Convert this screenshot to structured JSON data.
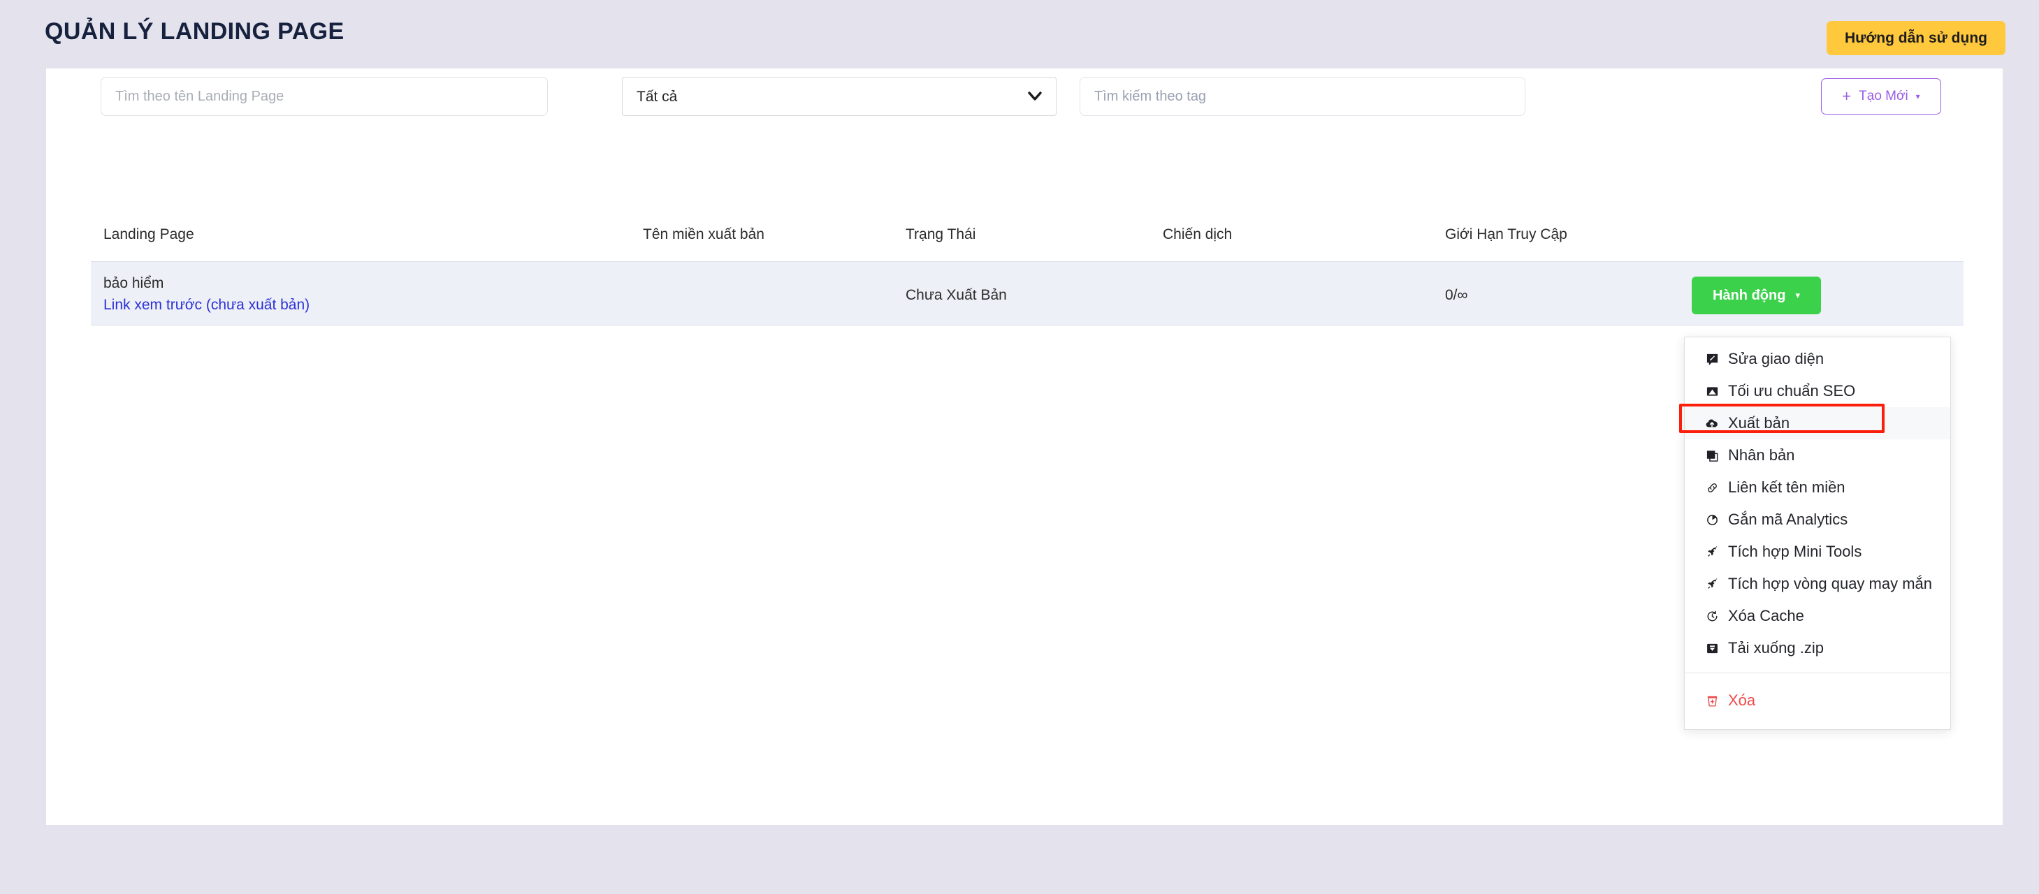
{
  "header": {
    "title": "QUẢN LÝ LANDING PAGE",
    "guide_button": "Hướng dẫn sử dụng",
    "accent_yellow": "#ffc83d",
    "title_color": "#16213e",
    "page_bg": "#e3e2ed"
  },
  "filters": {
    "name_search_placeholder": "Tìm theo tên Landing Page",
    "name_search_value": "",
    "status_select_value": "Tất cả",
    "status_select_options": [
      "Tất cả"
    ],
    "tag_search_placeholder": "Tìm kiếm theo tag",
    "tag_search_value": "",
    "create_button": {
      "plus": "+",
      "label": "Tạo Mới",
      "caret": "▾",
      "color": "#9b5de5"
    }
  },
  "table": {
    "columns": [
      "Landing Page",
      "Tên miền xuất bản",
      "Trạng Thái",
      "Chiến dịch",
      "Giới Hạn Truy Cập"
    ],
    "rows": [
      {
        "name": "bảo hiểm",
        "preview_link": "Link xem trước (chưa xuất bản)",
        "domain": "",
        "status": "Chưa Xuất Bản",
        "campaign": "",
        "access_limit": "0/∞",
        "action_button": "Hành động",
        "action_caret": "▾",
        "action_color": "#3bd14b"
      }
    ]
  },
  "dropdown": {
    "items": [
      {
        "label": "Sửa giao diện",
        "icon": "edit-interface-icon",
        "glyph": "✎"
      },
      {
        "label": "Tối ưu chuẩn SEO",
        "icon": "seo-image-icon",
        "glyph": "▨"
      },
      {
        "label": "Xuất bản",
        "icon": "cloud-upload-icon",
        "glyph": "☁",
        "highlighted": true
      },
      {
        "label": "Nhân bản",
        "icon": "duplicate-icon",
        "glyph": "❐"
      },
      {
        "label": "Liên kết tên miền",
        "icon": "link-icon",
        "glyph": "🔗"
      },
      {
        "label": "Gắn mã Analytics",
        "icon": "analytics-pie-icon",
        "glyph": "◐"
      },
      {
        "label": "Tích hợp Mini Tools",
        "icon": "rocket-icon",
        "glyph": "🚀"
      },
      {
        "label": "Tích hợp vòng quay may mắn",
        "icon": "rocket-icon",
        "glyph": "🚀"
      },
      {
        "label": "Xóa Cache",
        "icon": "history-clock-icon",
        "glyph": "↺"
      },
      {
        "label": "Tải xuống .zip",
        "icon": "download-icon",
        "glyph": "⬇"
      }
    ],
    "danger_item": {
      "label": "Xóa",
      "icon": "trash-icon",
      "glyph": "🗑",
      "color": "#ef4a4a"
    },
    "highlight_color": "#fb1e0b"
  }
}
